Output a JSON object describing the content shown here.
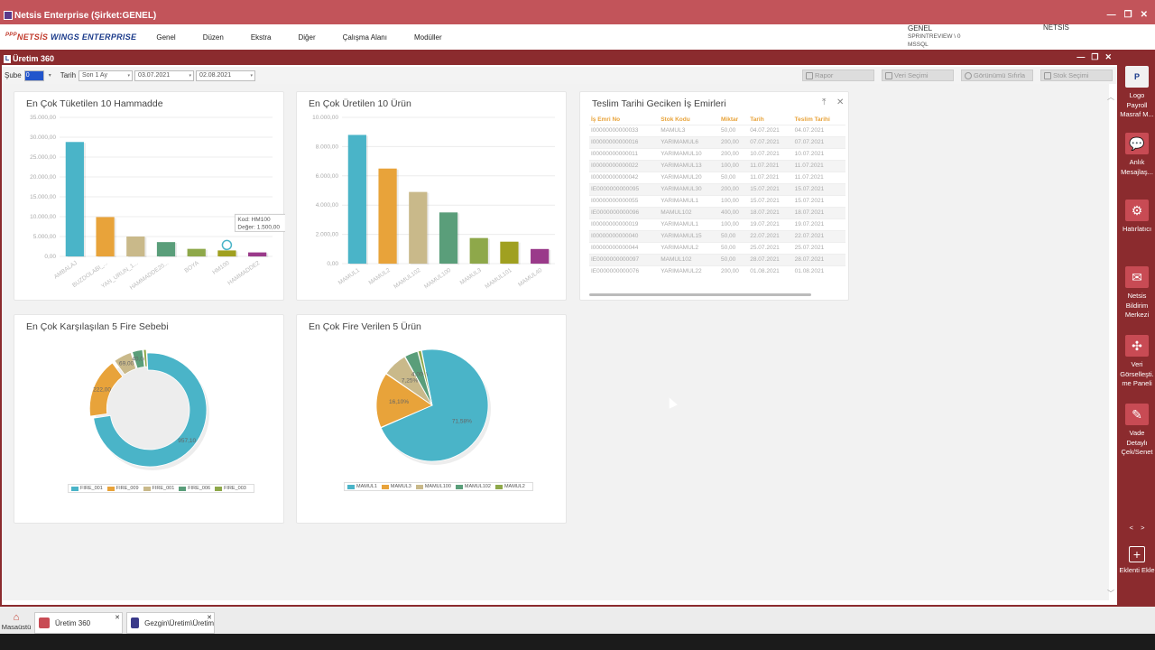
{
  "app": {
    "title": "Netsis Enterprise (Şirket:GENEL)",
    "logo_prefix": "NETSİS",
    "logo_suffix": "WINGS ENTERPRISE",
    "logo_pp": "PPP",
    "menu": [
      "Genel",
      "Düzen",
      "Ekstra",
      "Diğer",
      "Çalışma Alanı",
      "Modüller"
    ],
    "connection": {
      "company": "GENEL",
      "server": "SPRINTREVIEW \\ 0",
      "db": "MSSQL"
    },
    "user": "NETSIS"
  },
  "window": {
    "title": "Üretim 360"
  },
  "filters": {
    "sube_label": "Şube",
    "sube_value": "0",
    "tarih_label": "Tarih",
    "tarih_value": "Son 1 Ay",
    "date_from": "03.07.2021",
    "date_to": "02.08.2021",
    "buttons": [
      "Rapor",
      "Veri Seçimi",
      "Görünümü Sıfırla",
      "Stok Seçimi"
    ]
  },
  "charts": [
    {
      "type": "bar",
      "title": "En Çok Tüketilen 10 Hammadde",
      "categories": [
        "AMBALAJ",
        "BUZDOLABI_...",
        "YAN_URUN_1...",
        "HAMMADDE20...",
        "BOYA",
        "HM100",
        "HAMMADDE2"
      ],
      "values": [
        28800,
        9900,
        5000,
        3600,
        1900,
        1500,
        1000
      ],
      "colors": [
        "#4ab4c8",
        "#e8a33a",
        "#c9b98a",
        "#5a9e7a",
        "#8ea84a",
        "#a0a020",
        "#9a3a8a"
      ],
      "ylim": [
        0,
        35000
      ],
      "yticks": [
        "0,00",
        "5.000,00",
        "10.000,00",
        "15.000,00",
        "20.000,00",
        "25.000,00",
        "30.000,00",
        "35.000,00"
      ],
      "tooltip": {
        "line1": "Kod: HM100",
        "line2": "Değer: 1.500,00"
      }
    },
    {
      "type": "bar",
      "title": "En Çok Üretilen 10 Ürün",
      "categories": [
        "MAMUL1",
        "MAMUL2",
        "MAMUL102",
        "MAMUL100",
        "MAMUL3",
        "MAMUL101",
        "MAMUL40"
      ],
      "values": [
        8800,
        6500,
        4900,
        3500,
        1750,
        1500,
        1000
      ],
      "colors": [
        "#4ab4c8",
        "#e8a33a",
        "#c9b98a",
        "#5a9e7a",
        "#8ea84a",
        "#a0a020",
        "#9a3a8a"
      ],
      "ylim": [
        0,
        10000
      ],
      "yticks": [
        "0,00",
        "2.000,00",
        "4.000,00",
        "6.000,00",
        "8.000,00",
        "10.000,00"
      ]
    },
    {
      "type": "donut",
      "title": "En Çok Karşılaşılan 5 Fire Sebebi",
      "labels": [
        "FIRE_001",
        "FIRE_009",
        "FIRE_001",
        "FIRE_006",
        "FIRE_003"
      ],
      "values": [
        957.1,
        222.0,
        69.0,
        40.0,
        12.0
      ],
      "value_labels": [
        "957,10",
        "222,00",
        "69,00",
        "40,00",
        ""
      ],
      "colors": [
        "#4ab4c8",
        "#e8a33a",
        "#c9b98a",
        "#5a9e7a",
        "#8ea84a"
      ]
    },
    {
      "type": "pie",
      "title": "En Çok Fire Verilen 5 Ürün",
      "labels": [
        "MAMUL1",
        "MAMUL3",
        "MAMUL100",
        "MAMUL102",
        "MAMUL2"
      ],
      "values": [
        71.58,
        16.1,
        7.25,
        4.0,
        1.07
      ],
      "value_labels": [
        "71,58%",
        "16,10%",
        "7,25%",
        "4,00%",
        ""
      ],
      "colors": [
        "#4ab4c8",
        "#e8a33a",
        "#c9b98a",
        "#5a9e7a",
        "#8ea84a"
      ]
    }
  ],
  "chart_data": [
    {
      "type": "bar",
      "title": "En Çok Tüketilen 10 Hammadde",
      "categories": [
        "AMBALAJ",
        "BUZDOLABI_...",
        "YAN_URUN_1...",
        "HAMMADDE20...",
        "BOYA",
        "HM100",
        "HAMMADDE2"
      ],
      "values": [
        28800,
        9900,
        5000,
        3600,
        1900,
        1500,
        1000
      ],
      "ylim": [
        0,
        35000
      ]
    },
    {
      "type": "bar",
      "title": "En Çok Üretilen 10 Ürün",
      "categories": [
        "MAMUL1",
        "MAMUL2",
        "MAMUL102",
        "MAMUL100",
        "MAMUL3",
        "MAMUL101",
        "MAMUL40"
      ],
      "values": [
        8800,
        6500,
        4900,
        3500,
        1750,
        1500,
        1000
      ],
      "ylim": [
        0,
        10000
      ]
    },
    {
      "type": "pie",
      "title": "En Çok Karşılaşılan 5 Fire Sebebi",
      "labels": [
        "FIRE_001",
        "FIRE_009",
        "FIRE_001",
        "FIRE_006",
        "FIRE_003"
      ],
      "values": [
        957.1,
        222.0,
        69.0,
        40.0,
        12.0
      ]
    },
    {
      "type": "pie",
      "title": "En Çok Fire Verilen 5 Ürün",
      "labels": [
        "MAMUL1",
        "MAMUL3",
        "MAMUL100",
        "MAMUL102",
        "MAMUL2"
      ],
      "values": [
        71.58,
        16.1,
        7.25,
        4.0,
        1.07
      ]
    }
  ],
  "late_orders": {
    "title": "Teslim Tarihi Geciken İş Emirleri",
    "columns": [
      "İş Emri No",
      "Stok Kodu",
      "Miktar",
      "Tarih",
      "Teslim Tarihi"
    ],
    "rows": [
      [
        "I00000000000033",
        "MAMUL3",
        "50,00",
        "04.07.2021",
        "04.07.2021"
      ],
      [
        "I00000000000016",
        "YARIMAMUL6",
        "200,00",
        "07.07.2021",
        "07.07.2021"
      ],
      [
        "I00000000000011",
        "YARIMAMUL10",
        "200,00",
        "10.07.2021",
        "10.07.2021"
      ],
      [
        "I00000000000022",
        "YARIMAMUL13",
        "100,00",
        "11.07.2021",
        "11.07.2021"
      ],
      [
        "I00000000000042",
        "YARIMAMUL20",
        "50,00",
        "11.07.2021",
        "11.07.2021"
      ],
      [
        "IE0000000000095",
        "YARIMAMUL30",
        "200,00",
        "15.07.2021",
        "15.07.2021"
      ],
      [
        "I00000000000055",
        "YARIMAMUL1",
        "100,00",
        "15.07.2021",
        "15.07.2021"
      ],
      [
        "IE0000000000096",
        "MAMUL102",
        "400,00",
        "18.07.2021",
        "18.07.2021"
      ],
      [
        "I00000000000019",
        "YARIMAMUL1",
        "100,00",
        "19.07.2021",
        "19.07.2021"
      ],
      [
        "I00000000000040",
        "YARIMAMUL15",
        "50,00",
        "22.07.2021",
        "22.07.2021"
      ],
      [
        "I00000000000044",
        "YARIMAMUL2",
        "50,00",
        "25.07.2021",
        "25.07.2021"
      ],
      [
        "IE0000000000097",
        "MAMUL102",
        "50,00",
        "28.07.2021",
        "28.07.2021"
      ],
      [
        "IE0000000000076",
        "YARIMAMUL22",
        "200,00",
        "01.08.2021",
        "01.08.2021"
      ]
    ]
  },
  "right_panel": [
    {
      "icon": "P",
      "label": "Logo Payroll Masraf M..."
    },
    {
      "icon": "💬",
      "label": "Anlık Mesajlaş..."
    },
    {
      "icon": "⚙",
      "label": "Hatırlatıcı"
    },
    {
      "icon": "✉",
      "label": "Netsis Bildirim Merkezi"
    },
    {
      "icon": "✣",
      "label": "Veri Görselleşti. me Paneli"
    },
    {
      "icon": "✎",
      "label": "Vade Detaylı Çek/Senet"
    }
  ],
  "right_panel_extra": {
    "add_label": "Eklenti Ekle",
    "prev": "<",
    "next": ">"
  },
  "taskbar": {
    "home_label": "Masaüstü",
    "tasks": [
      "Üretim 360",
      "Gezgin\\Üretim\\Üretim"
    ]
  }
}
